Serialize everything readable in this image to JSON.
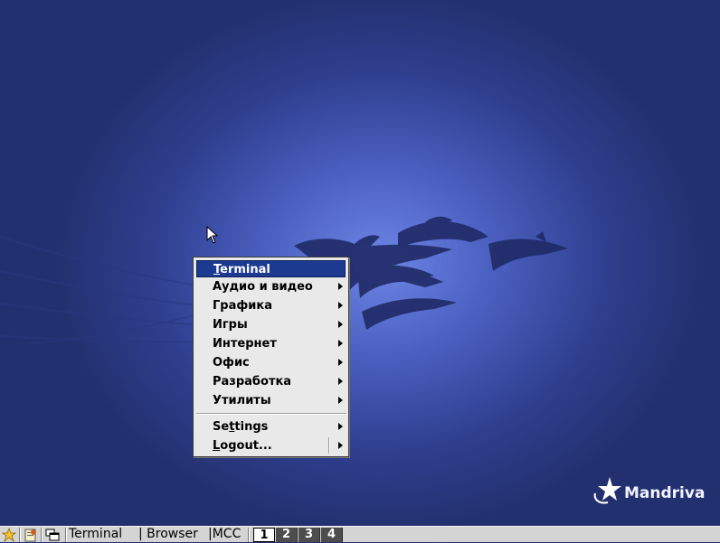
{
  "desktop": {
    "brand_name": "Mandriva"
  },
  "menu": {
    "items": [
      {
        "label": "Terminal",
        "accel": "T",
        "rest": "erminal",
        "active": true,
        "submenu": false
      },
      {
        "label": "Аудио и видео",
        "submenu": true
      },
      {
        "label": "Графика",
        "submenu": true
      },
      {
        "label": "Игры",
        "submenu": true
      },
      {
        "label": "Интернет",
        "submenu": true
      },
      {
        "label": "Офис",
        "submenu": true
      },
      {
        "label": "Разработка",
        "submenu": true
      },
      {
        "label": "Утилиты",
        "submenu": true
      }
    ],
    "settings": {
      "pre": "Se",
      "accel": "t",
      "post": "tings"
    },
    "logout": {
      "accel": "L",
      "post": "ogout..."
    }
  },
  "taskbar": {
    "launcher_icons": [
      "star-icon",
      "document-icon",
      "windows-icon"
    ],
    "tasks": [
      " Terminal",
      "| Browser",
      "|MCC"
    ],
    "workspaces": [
      "1",
      "2",
      "3",
      "4"
    ],
    "current_workspace": "1"
  },
  "colors": {
    "menu_highlight": "#1c3a8f",
    "menu_bg": "#e9e9e9",
    "taskbar_bg": "#d4d4d4",
    "desktop_center": "#6f86e6",
    "desktop_edge": "#23306f"
  }
}
